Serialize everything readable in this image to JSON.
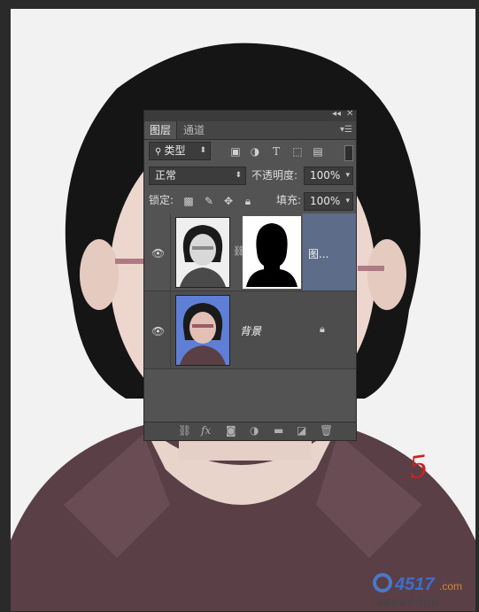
{
  "panel": {
    "tabs": [
      {
        "label": "图层"
      },
      {
        "label": "通道"
      }
    ],
    "filter": {
      "kind_label": "类型"
    },
    "blend": {
      "mode": "正常",
      "opacity_label": "不透明度:",
      "opacity_value": "100%"
    },
    "lock": {
      "label": "锁定:",
      "fill_label": "填充:",
      "fill_value": "100%"
    },
    "layers": [
      {
        "name": "图...",
        "selected": true,
        "has_mask": true
      },
      {
        "name": "背景",
        "selected": false,
        "locked": true
      }
    ]
  },
  "watermark": {
    "brand": "4517.com",
    "site_cn": "电脑软硬件应用网"
  },
  "signature": "5",
  "colors": {
    "panel_bg": "#535353",
    "selected_layer": "#5d6d89",
    "photo_blue_bg": "#5f7fd6",
    "signature": "#cc2222"
  }
}
